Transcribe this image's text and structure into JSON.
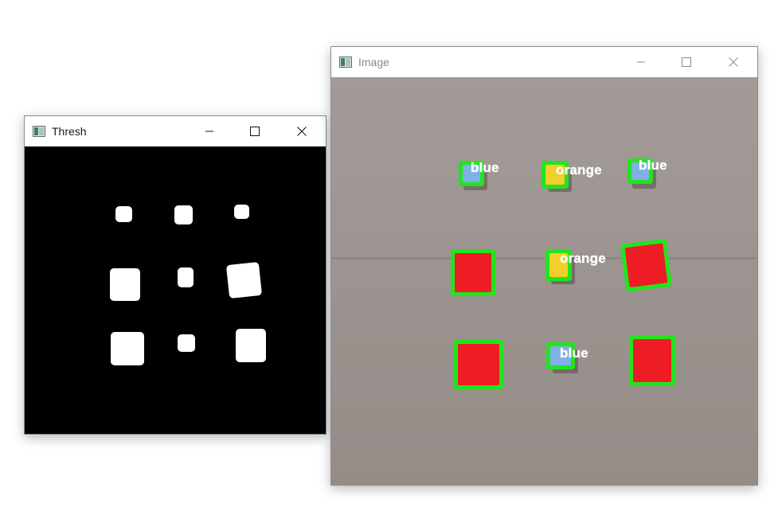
{
  "thresh_window": {
    "title": "Thresh",
    "icon": "opencv-window-icon",
    "controls": [
      "minimize",
      "maximize",
      "close"
    ]
  },
  "image_window": {
    "title": "Image",
    "icon": "opencv-window-icon",
    "controls": [
      "minimize",
      "maximize",
      "close"
    ],
    "detections": [
      {
        "label": "blue",
        "color": "#7fb0e6"
      },
      {
        "label": "orange",
        "color": "#f2cf2a"
      },
      {
        "label": "blue",
        "color": "#7fb0e6"
      },
      {
        "label": "",
        "color": "#ee1c24"
      },
      {
        "label": "orange",
        "color": "#f2cf2a"
      },
      {
        "label": "",
        "color": "#ee1c24"
      },
      {
        "label": "",
        "color": "#ee1c24"
      },
      {
        "label": "blue",
        "color": "#7fb0e6"
      },
      {
        "label": "",
        "color": "#ee1c24"
      }
    ],
    "contour_color": "#22e41e"
  }
}
